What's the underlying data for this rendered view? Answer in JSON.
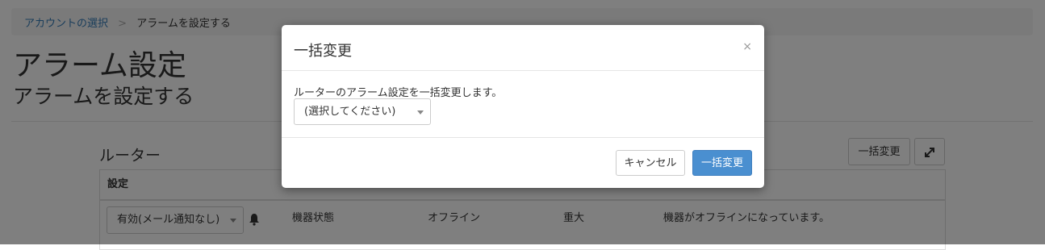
{
  "breadcrumb": {
    "link": "アカウントの選択",
    "separator": ">",
    "current": "アラームを設定する"
  },
  "page": {
    "title": "アラーム設定",
    "subtitle": "アラームを設定する"
  },
  "section": {
    "title": "ルーター",
    "bulk_button": "一括変更",
    "expand_icon": "expand-icon"
  },
  "table": {
    "headers": [
      "設定",
      "",
      "",
      "",
      ""
    ],
    "row": {
      "setting": "有効(メール通知なし)",
      "bell_icon": "bell-icon",
      "item": "機器状態",
      "state": "オフライン",
      "severity": "重大",
      "description": "機器がオフラインになっています。"
    }
  },
  "modal": {
    "title": "一括変更",
    "close": "×",
    "description": "ルーターのアラーム設定を一括変更します。",
    "select_value": "(選択してください)",
    "cancel_label": "キャンセル",
    "confirm_label": "一括変更"
  },
  "colors": {
    "link": "#337ab7",
    "primary": "#4a8fd0",
    "overlay": "rgba(0,0,0,0.5)"
  }
}
